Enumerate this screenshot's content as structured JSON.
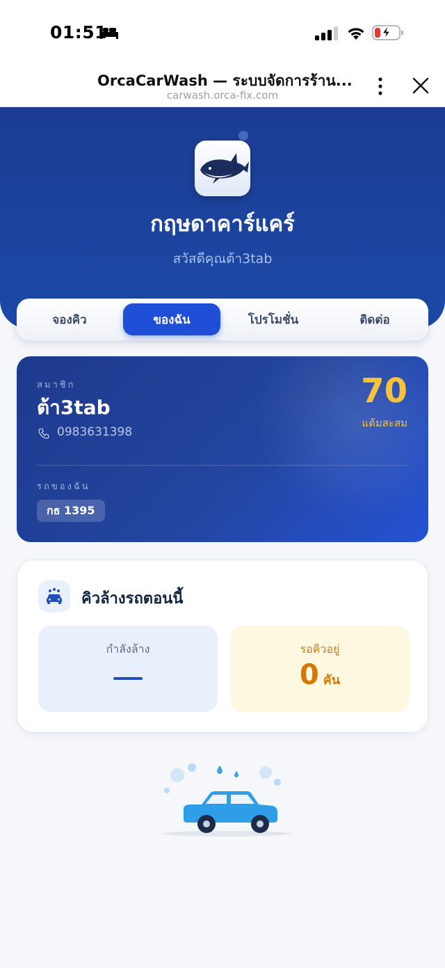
{
  "status_bar": {
    "time": "01:51"
  },
  "browser": {
    "title": "OrcaCarWash — ระบบจัดการร้าน...",
    "url": "carwash.orca-fix.com"
  },
  "hero": {
    "shop_name": "กฤษดาคาร์แคร์",
    "greeting": "สวัสดีคุณต้า3tab"
  },
  "tabs": [
    {
      "label": "จองคิว"
    },
    {
      "label": "ของฉัน"
    },
    {
      "label": "โปรโมชั่น"
    },
    {
      "label": "ติดต่อ"
    }
  ],
  "member": {
    "section_label": "สมาชิก",
    "name": "ต้า3tab",
    "phone": "0983631398",
    "points": "70",
    "points_label": "แต้มสะสม",
    "cars_label": "รถของฉัน",
    "plate": "กธ 1395"
  },
  "queue": {
    "title": "คิวล้างรถตอนนี้",
    "washing_label": "กำลังล้าง",
    "waiting_label": "รอคิวอยู่",
    "waiting_count": "0",
    "waiting_unit": "คัน"
  },
  "colors": {
    "primary": "#1f4fd6",
    "hero_bg": "#1c3c92",
    "points": "#f8c23a",
    "waiting": "#d77700"
  }
}
